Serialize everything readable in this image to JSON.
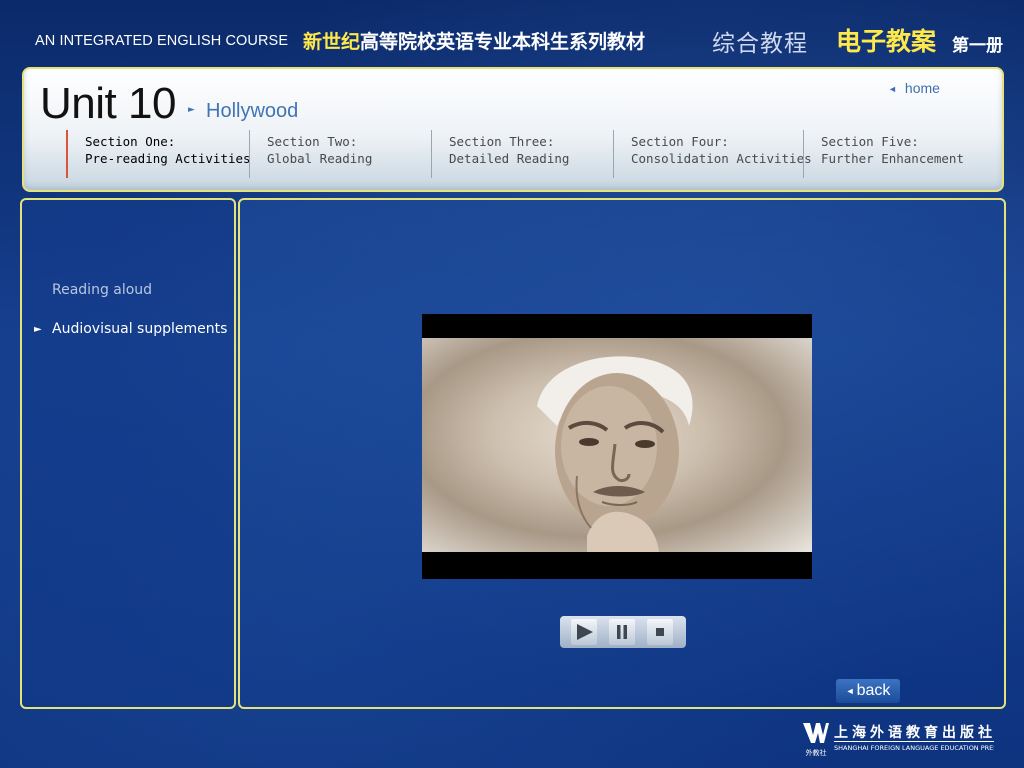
{
  "banner": {
    "course_en": "AN INTEGRATED ENGLISH COURSE",
    "course_cn_highlight": "新世纪",
    "course_cn_rest": "高等院校英语专业本科生系列教材",
    "tutorial_cn": "综合教程",
    "plan_cn": "电子教案",
    "volume_cn": "第一册"
  },
  "header": {
    "unit_title": "Unit 10",
    "unit_subtitle": "Hollywood",
    "home_label": "home",
    "sections": [
      {
        "line1": "Section One:",
        "line2": "Pre-reading Activities",
        "active": true
      },
      {
        "line1": "Section Two:",
        "line2": "Global Reading",
        "active": false
      },
      {
        "line1": "Section Three:",
        "line2": "Detailed Reading",
        "active": false
      },
      {
        "line1": "Section Four:",
        "line2": "Consolidation Activities",
        "active": false
      },
      {
        "line1": "Section Five:",
        "line2": "Further Enhancement",
        "active": false
      }
    ]
  },
  "sidebar": {
    "items": [
      {
        "label": "Reading aloud",
        "active": false
      },
      {
        "label": "Audiovisual supplements",
        "active": true
      }
    ]
  },
  "player": {
    "buttons": [
      "play",
      "pause",
      "stop"
    ]
  },
  "back_label": "back",
  "publisher": {
    "logo_cn": "外教社",
    "name_cn": "上海外语教育出版社",
    "name_en": "SHANGHAI FOREIGN LANGUAGE EDUCATION PRESS"
  },
  "colors": {
    "accent_yellow": "#ffe84a",
    "panel_border": "#e6e27a",
    "link_blue": "#3f74b5",
    "active_section_marker": "#d8543c"
  }
}
